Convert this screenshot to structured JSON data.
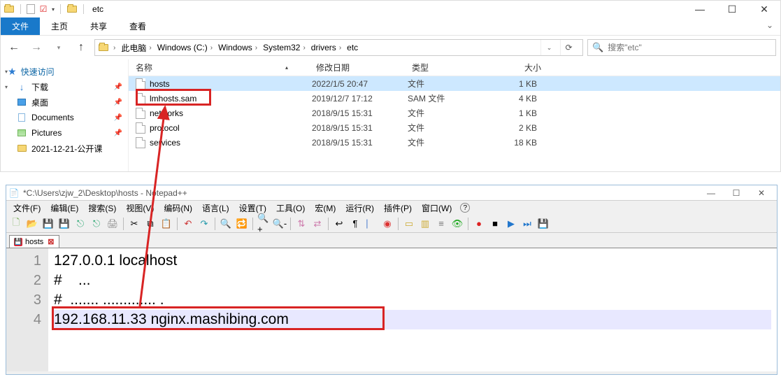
{
  "explorer": {
    "title": "etc",
    "ribbon": {
      "file": "文件",
      "home": "主页",
      "share": "共享",
      "view": "查看"
    },
    "breadcrumb": [
      "此电脑",
      "Windows (C:)",
      "Windows",
      "System32",
      "drivers",
      "etc"
    ],
    "search_placeholder": "搜索\"etc\"",
    "side": {
      "quick": "快速访问",
      "download": "下载",
      "desktop": "桌面",
      "documents": "Documents",
      "pictures": "Pictures",
      "class": "2021-12-21-公开课"
    },
    "columns": {
      "name": "名称",
      "date": "修改日期",
      "type": "类型",
      "size": "大小"
    },
    "rows": [
      {
        "name": "hosts",
        "date": "2022/1/5 20:47",
        "type": "文件",
        "size": "1 KB",
        "selected": true
      },
      {
        "name": "lmhosts.sam",
        "date": "2019/12/7 17:12",
        "type": "SAM 文件",
        "size": "4 KB",
        "selected": false
      },
      {
        "name": "networks",
        "date": "2018/9/15 15:31",
        "type": "文件",
        "size": "1 KB",
        "selected": false
      },
      {
        "name": "protocol",
        "date": "2018/9/15 15:31",
        "type": "文件",
        "size": "2 KB",
        "selected": false
      },
      {
        "name": "services",
        "date": "2018/9/15 15:31",
        "type": "文件",
        "size": "18 KB",
        "selected": false
      }
    ]
  },
  "npp": {
    "title": "*C:\\Users\\zjw_2\\Desktop\\hosts - Notepad++",
    "menu": {
      "file": "文件(F)",
      "edit": "编辑(E)",
      "search": "搜索(S)",
      "view": "视图(V)",
      "encoding": "编码(N)",
      "language": "语言(L)",
      "settings": "设置(T)",
      "tools": "工具(O)",
      "macro": "宏(M)",
      "run": "运行(R)",
      "plugins": "插件(P)",
      "window": "窗口(W)",
      "help": "?"
    },
    "tab": "hosts",
    "gutter": [
      "1",
      "2",
      "3",
      "4"
    ],
    "lines": [
      "127.0.0.1 localhost",
      "#    ...",
      "#  ....... ............. .",
      "192.168.11.33 nginx.mashibing.com"
    ]
  }
}
